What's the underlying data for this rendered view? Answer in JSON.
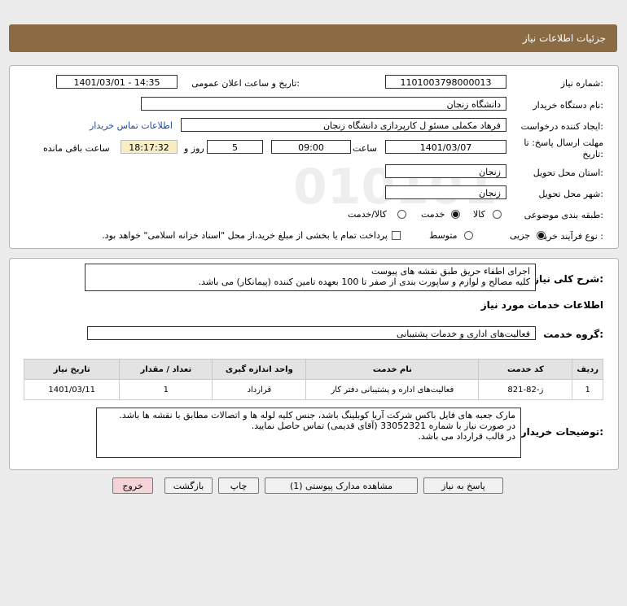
{
  "page": {
    "title": "جزئیات اطلاعات نیاز"
  },
  "form": {
    "need_number_label": "شماره نیاز:",
    "need_number": "1101003798000013",
    "announce_label": "تاریخ و ساعت اعلان عمومی:",
    "announce_value": "1401/03/01 - 14:35",
    "buyer_org_label": "نام دستگاه خریدار:",
    "buyer_org": "دانشگاه زنجان",
    "creator_label": "ایجاد کننده درخواست:",
    "creator": "فرهاد مکملی مسئو ل کارپردازی دانشگاه زنجان",
    "contact_link": "اطلاعات تماس خریدار",
    "deadline_label_1": "مهلت ارسال پاسخ: تا",
    "deadline_label_2": "تاریخ:",
    "deadline_date": "1401/03/07",
    "time_label": "ساعت",
    "deadline_time": "09:00",
    "days_value": "5",
    "days_label": "روز و",
    "remaining_time": "18:17:32",
    "remaining_label": "ساعت باقی مانده",
    "province_label": "استان محل تحویل:",
    "province": "زنجان",
    "city_label": "شهر محل تحویل:",
    "city": "زنجان",
    "category_label": "طبقه بندی موضوعی:",
    "category_options": [
      "کالا",
      "خدمت",
      "کالا/خدمت"
    ],
    "category_selected": "خدمت",
    "process_label": "نوع فرآیند خرید :",
    "process_options": [
      "جزیی",
      "متوسط"
    ],
    "process_selected": "جزیی",
    "payment_note": "پرداخت تمام یا بخشی از مبلغ خرید،از محل \"اسناد خزانه اسلامی\" خواهد بود."
  },
  "summary": {
    "label": "شرح کلی نیاز:",
    "lines": [
      "اجرای اطفاء حریق طبق نقشه های پیوست",
      "کلیه مصالح و لوازم و ساپورت بندی از صفر تا 100 بعهده تامین کننده (پیمانکار) می باشد."
    ]
  },
  "services": {
    "section_title": "اطلاعات خدمات مورد نیاز",
    "group_label": "گروه خدمت:",
    "group_value": "فعالیت‌های اداری و خدمات پشتیبانی",
    "columns": [
      "ردیف",
      "کد خدمت",
      "نام خدمت",
      "واحد اندازه گیری",
      "تعداد / مقدار",
      "تاریخ نیاز"
    ],
    "rows": [
      {
        "row": "1",
        "code": "ز-82-821",
        "name": "فعالیت‌های اداره و پشتیبانی دفتر کار",
        "unit": "قرارداد",
        "qty": "1",
        "date": "1401/03/11"
      }
    ]
  },
  "buyer_notes": {
    "label": "توضیحات خریدار:",
    "lines": [
      "مارک جعبه های فایل باکس شرکت آریا کوبلینگ باشد، جنس کلیه لوله ها و اتصالات مطابق با نقشه ها باشد.",
      "در صورت نیاز با شماره 33052321 (آقای قدیمی) تماس حاصل نمایید.",
      "در قالب قرارداد می باشد."
    ]
  },
  "buttons": {
    "reply": "پاسخ به نیاز",
    "attachments": "مشاهده مدارک پیوستی (1)",
    "print": "چاپ",
    "back": "بازگشت",
    "exit": "خروج"
  },
  "colors": {
    "header": "#8b6b44",
    "link": "#1a49a8",
    "remaining_bg": "#f7efc3",
    "exit_bg": "#f6d3d8"
  }
}
